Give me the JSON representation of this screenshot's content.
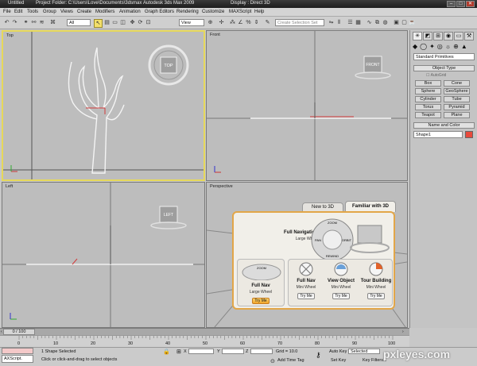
{
  "titlebar": {
    "items": [
      "Untitled",
      "Project Folder: C:\\Users\\Love\\Documents\\3dsmax",
      "Autodesk 3ds Max 2009",
      "Display : Direct 3D"
    ]
  },
  "menu": [
    "File",
    "Edit",
    "Tools",
    "Group",
    "Views",
    "Create",
    "Modifiers",
    "Animation",
    "Graph Editors",
    "Rendering",
    "Customize",
    "MAXScript",
    "Help"
  ],
  "toolbar": {
    "selection_filter": "All",
    "reference_coord": "View",
    "named_selection_placeholder": "Create Selection Set"
  },
  "viewports": {
    "top": {
      "label": "Top",
      "cube": "TOP"
    },
    "front": {
      "label": "Front",
      "cube": "FRONT"
    },
    "left": {
      "label": "Left",
      "cube": "LEFT"
    },
    "perspective": {
      "label": "Perspective"
    }
  },
  "command_panel": {
    "dropdown": "Standard Primitives",
    "section_object_type": "Object Type",
    "autogrid": "AutoGrid",
    "buttons": [
      "Box",
      "Cone",
      "Sphere",
      "GeoSphere",
      "Cylinder",
      "Tube",
      "Torus",
      "Pyramid",
      "Teapot",
      "Plane"
    ],
    "section_name_color": "Name and Color",
    "object_name": "Shape1",
    "object_color": "#e84a3c"
  },
  "time": {
    "frame": "0 / 100",
    "ticks": [
      "0",
      "10",
      "20",
      "30",
      "40",
      "50",
      "60",
      "70",
      "80",
      "90",
      "100"
    ]
  },
  "status": {
    "maxscript": "AXScript.",
    "selection": "1 Shape Selected",
    "prompt": "Click or click-and-drag to select objects",
    "x_label": "X",
    "y_label": "Y",
    "z_label": "Z",
    "grid": "Grid = 10.0",
    "add_time_tag": "Add Time Tag",
    "auto_key": "Auto Key",
    "set_key": "Set Key",
    "key_mode": "Selected",
    "key_filters": "Key Filters..."
  },
  "steering_wheels": {
    "tab_new": "New to 3D",
    "tab_familiar": "Familiar with 3D",
    "full_navigation": "Full Navigation",
    "full_navigation_sub": "Large Wheel",
    "wheel_labels": [
      "ZOOM",
      "PAN",
      "ORBIT",
      "REWIND"
    ],
    "full_nav_large_title": "Full Nav",
    "full_nav_large_sub": "Large Wheel",
    "full_nav_mini_title": "Full Nav",
    "full_nav_mini_sub": "Mini Wheel",
    "view_object_title": "View Object",
    "view_object_sub": "Mini Wheel",
    "tour_building_title": "Tour Building",
    "tour_building_sub": "Mini Wheel",
    "try_me": "Try Me",
    "zoom_label": "ZOOM"
  },
  "watermark": "pxleyes.com"
}
